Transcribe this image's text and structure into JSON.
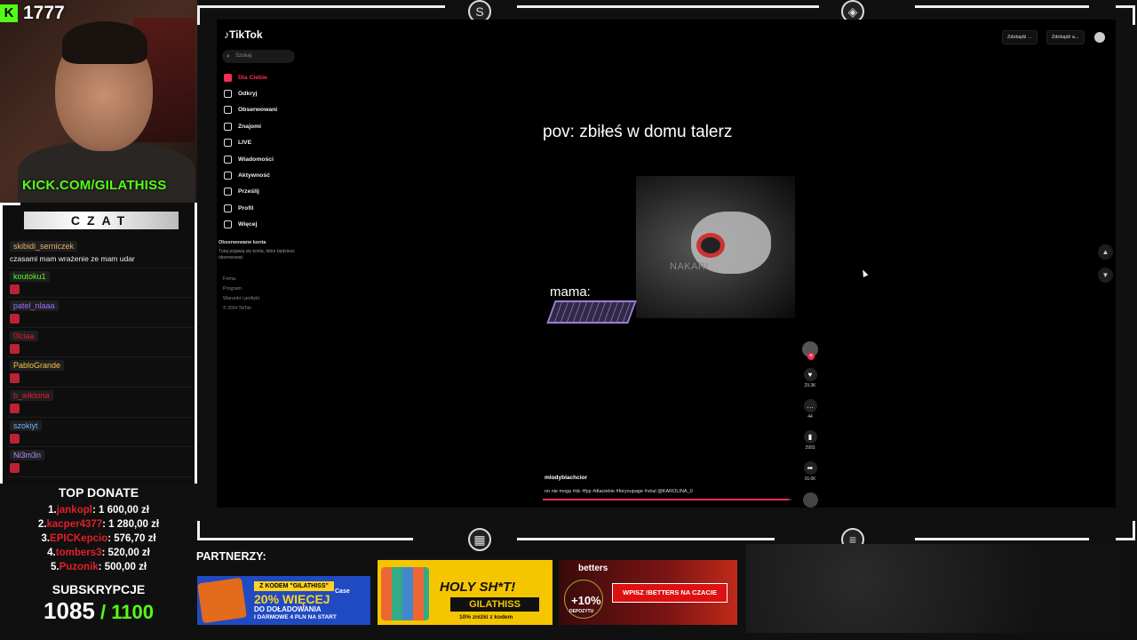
{
  "stream": {
    "viewer_count": "1777",
    "kick_url_prefix": "KICK.COM/",
    "kick_url_name": "GILATHISS"
  },
  "chat": {
    "header": "CZAT",
    "messages": [
      {
        "user": "skibidi_serniczek",
        "user_color": "#e7b06a",
        "text": "czasami mam wrażenie ze mam udar",
        "emote": false
      },
      {
        "user": "koutoku1",
        "user_color": "#53fc18",
        "text": "",
        "emote": true
      },
      {
        "user": "patel_nlaaa",
        "user_color": "#a06cff",
        "text": "",
        "emote": true
      },
      {
        "user": "0lciaa",
        "user_color": "#e0202a",
        "text": "",
        "emote": true
      },
      {
        "user": "PabloGrande",
        "user_color": "#f3c44a",
        "text": "",
        "emote": true
      },
      {
        "user": "b_wiktoria",
        "user_color": "#e0202a",
        "text": "",
        "emote": true
      },
      {
        "user": "szokiyt",
        "user_color": "#6ab7ff",
        "text": "",
        "emote": true
      },
      {
        "user": "Ni3m3n",
        "user_color": "#b58cff",
        "text": "",
        "emote": true
      }
    ]
  },
  "donate": {
    "title": "TOP DONATE",
    "rows": [
      {
        "rank": "1.",
        "name": "jankopl",
        "amount": ": 1 600,00 zł"
      },
      {
        "rank": "2.",
        "name": "kacper4377",
        "amount": ": 1 280,00 zł"
      },
      {
        "rank": "3.",
        "name": "EPICKepcio",
        "amount": ": 576,70 zł"
      },
      {
        "rank": "4.",
        "name": "tombers3",
        "amount": ": 520,00 zł"
      },
      {
        "rank": "5.",
        "name": "Puzonik",
        "amount": ": 500,00 zł"
      }
    ]
  },
  "subs": {
    "title": "SUBSKRYPCJE",
    "current": "1085",
    "goal": " / 1100"
  },
  "tiktok": {
    "logo": "TikTok",
    "search_placeholder": "Szukaj",
    "nav": [
      {
        "label": "Dla Ciebie",
        "active": true
      },
      {
        "label": "Odkryj",
        "active": false
      },
      {
        "label": "Obserwowani",
        "active": false
      },
      {
        "label": "Znajomi",
        "active": false
      },
      {
        "label": "LIVE",
        "active": false
      },
      {
        "label": "Wiadomości",
        "active": false
      },
      {
        "label": "Aktywność",
        "active": false
      },
      {
        "label": "Prześlij",
        "active": false
      },
      {
        "label": "Profil",
        "active": false
      },
      {
        "label": "Więcej",
        "active": false
      }
    ],
    "following_title": "Obserwowane konta",
    "following_desc": "Tutaj pojawią się konta, które będziesz obserwować",
    "footer": [
      "Firma",
      "Program",
      "Warunki i polityki",
      "© 2024 TikTok"
    ],
    "top_buttons": [
      "Zdobądź ...",
      "Zdobądź a..."
    ],
    "video": {
      "caption": "pov: zbiłeś w domu talerz",
      "label": "mama:",
      "watermark": "NAKARI",
      "author": "mlodyblachcior",
      "description": "no nie mogę #dc #fyp #dlaciebie #foryoupage #viral @KAROLINA_0",
      "progress": 0.99
    },
    "actions": {
      "likes": "29.3K",
      "comments": "44",
      "saves": "2993",
      "shares": "16.6K"
    }
  },
  "partners": {
    "title": "PARTNERZY:",
    "ads": [
      {
        "code_label": "Z KODEM \"GILATHISS\"",
        "headline": "20% WIĘCEJ",
        "line2": "DO DOŁADOWANIA",
        "line3": "I DARMOWE 4 PLN NA START",
        "brand": "Case"
      },
      {
        "headline": "HOLY SH*T!",
        "code": "GILATHISS",
        "note": "10% zniżki z kodem"
      },
      {
        "brand": "betters",
        "bonus": "+10%",
        "bonus_note": "DEPOZYTU",
        "cta": "WPISZ !BETTERS NA CZACIE"
      }
    ]
  },
  "colors": {
    "kick_green": "#53fc18",
    "tiktok_red": "#fe2c55",
    "donor_red": "#e0202a"
  }
}
